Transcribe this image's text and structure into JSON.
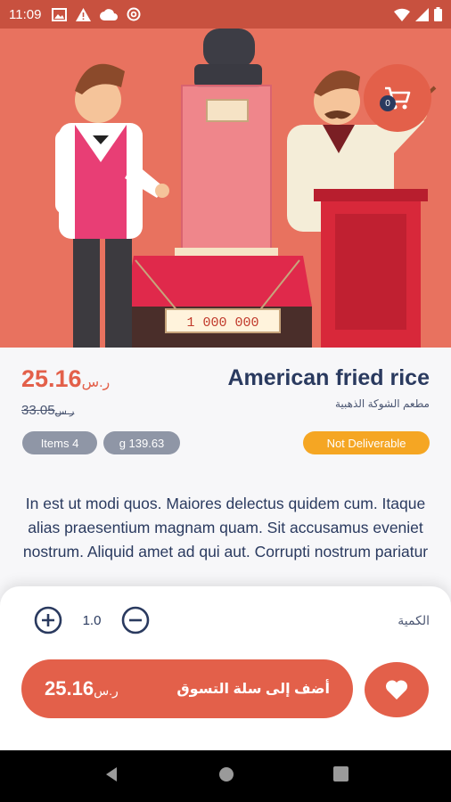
{
  "status_bar": {
    "time": "11:09"
  },
  "hero": {
    "price_tag": "1 000 000"
  },
  "cart": {
    "count": "0"
  },
  "product": {
    "name": "American fried rice",
    "restaurant": "مطعم الشوكة الذهبية",
    "price": "25.16",
    "currency": "ر.س",
    "old_price": "33.05",
    "items_pill": "Items 4",
    "weight_pill": "g 139.63",
    "delivery_badge": "Not Deliverable",
    "description": "In est ut modi quos. Maiores delectus quidem cum. Itaque alias praesentium magnam quam. Sit accusamus eveniet nostrum. Aliquid amet ad qui aut. Corrupti nostrum pariatur"
  },
  "quantity": {
    "label": "الكمية",
    "value": "1.0"
  },
  "add_to_cart": {
    "label": "أضف إلى سلة التسوق",
    "price": "25.16",
    "currency": "ر.س"
  },
  "colors": {
    "accent": "#e3604a",
    "navy": "#2a3a5f",
    "warning": "#f5a623",
    "pill_gray": "#8f96a6"
  },
  "icons": [
    "gallery-icon",
    "warning-icon",
    "cloud-icon",
    "at-icon",
    "wifi-icon",
    "signal-icon",
    "battery-icon",
    "cart-icon",
    "add-circle-icon",
    "remove-circle-icon",
    "heart-icon",
    "back-icon",
    "home-icon",
    "recents-icon"
  ]
}
